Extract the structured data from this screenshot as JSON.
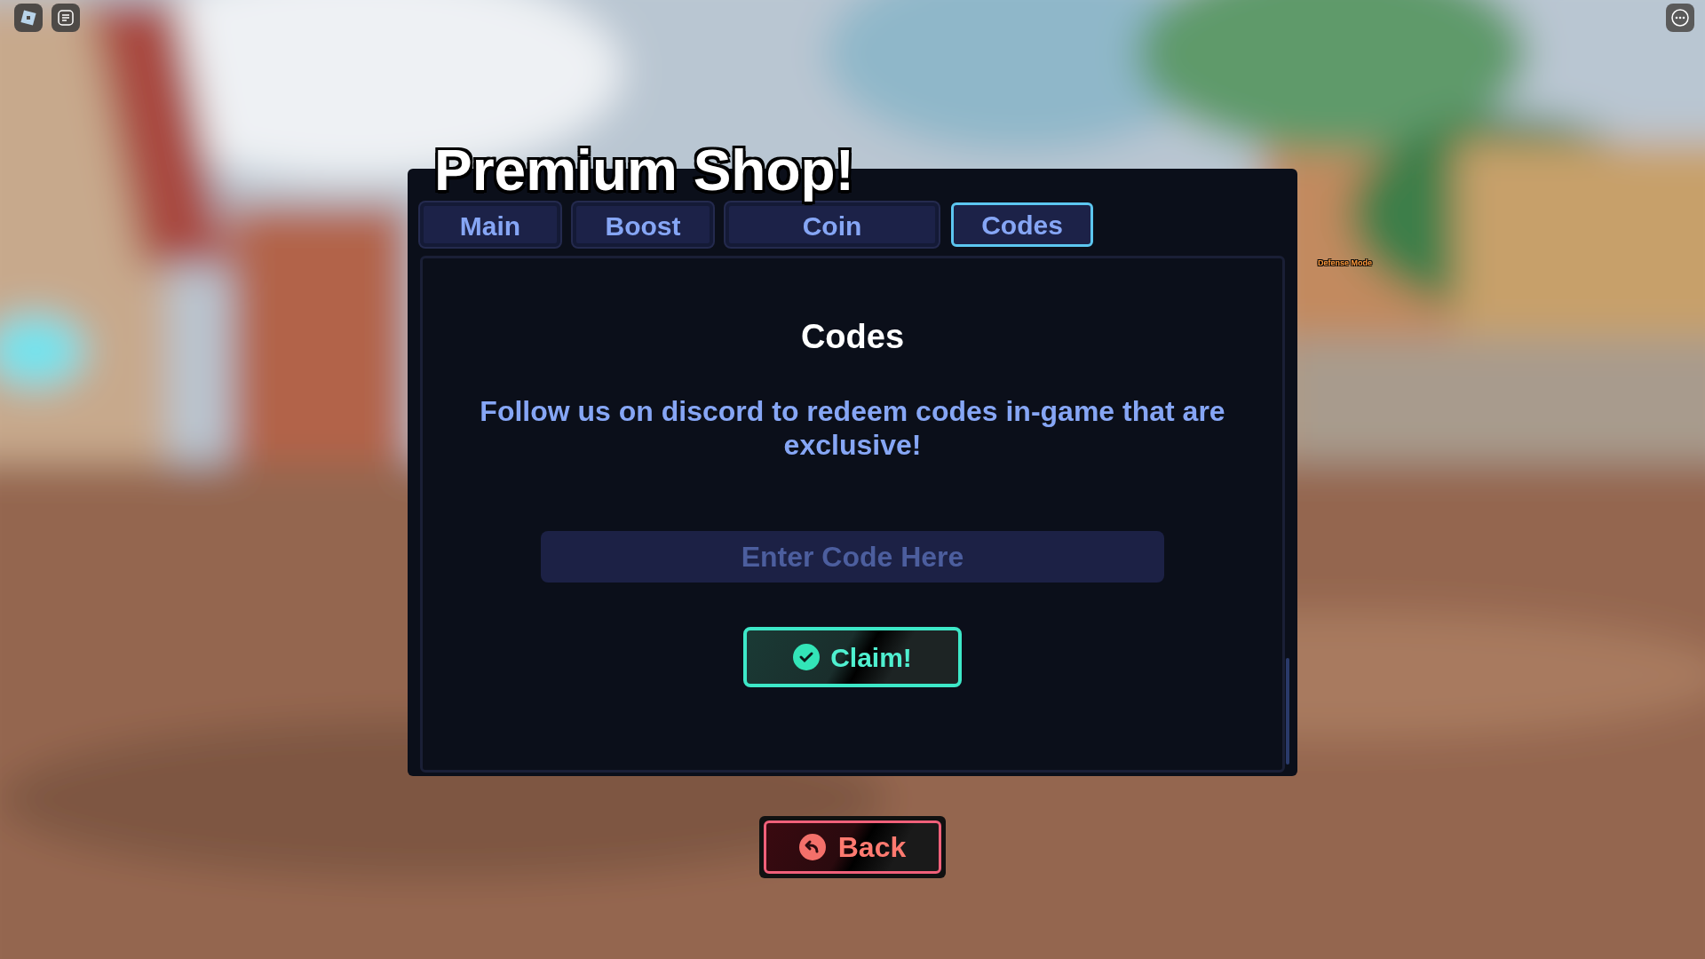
{
  "overlay_label": "Defense Mode",
  "shop": {
    "title": "Premium Shop!",
    "tabs": [
      {
        "label": "Main",
        "selected": false
      },
      {
        "label": "Boost",
        "selected": false
      },
      {
        "label": "Coin",
        "selected": false
      },
      {
        "label": "Codes",
        "selected": true
      }
    ],
    "heading": "Codes",
    "message": "Follow us on discord to redeem codes in-game that are exclusive!",
    "code_field": {
      "placeholder": "Enter Code Here"
    },
    "claim_button": "Claim!"
  },
  "back_button": "Back"
}
